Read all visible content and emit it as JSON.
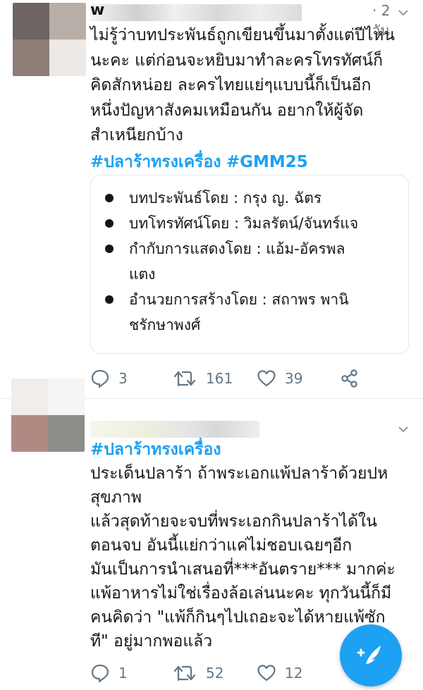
{
  "tweets": [
    {
      "author_visible_char": "w",
      "time": "· 2 วัน",
      "text_lines": [
        "ไม่รู้ว่าบทประพันธ์ถูกเขียนขึ้นมาตั้งแต่ปีไหน",
        "นะคะ แต่ก่อนจะหยิบมาทำละครโทรทัศน์ก็",
        "คิดสักหน่อย ละครไทยแย่ๆแบบนี้ก็เป็นอีก",
        "หนึ่งปัญหาสังคมเหมือนกัน อยากให้ผู้จัด",
        "สำเหนียกบ้าง"
      ],
      "hashtags": [
        "#ปลาร้าทรงเครื่อง",
        "#GMM25"
      ],
      "card_items": [
        [
          "บทประพันธ์โดย : กรุง ญ. ฉัตร"
        ],
        [
          "บทโทรทัศน์โดย : วิมลรัตน์/จันทร์แจ"
        ],
        [
          "กำกับการแสดงโดย : แอ้ม-อัครพล ",
          "แตง"
        ],
        [
          "อำนวยการสร้างโดย : สถาพร พานิ",
          "ชรักษาพงศ์"
        ]
      ],
      "replies": "3",
      "retweets": "161",
      "likes": "39"
    },
    {
      "hashtag": "#ปลาร้าทรงเครื่อง",
      "text_lines": [
        "ประเด็นปลาร้า ถ้าพระเอกแพ้ปลาร้าด้วยปห",
        "สุขภาพ",
        "แล้วสุดท้ายจะจบที่พระเอกกินปลาร้าได้ใน",
        "ตอนจบ อันนี้แย่กว่าแค่ไม่ชอบเฉยๆอีก",
        "มันเป็นการนำเสนอที่***อันตราย*** มากค่ะ",
        "แพ้อาหารไม่ใช่เรื่องล้อเล่นนะคะ ทุกวันนี้ก็มี",
        "คนคิดว่า \"แพ้ก็กินๆไปเถอะจะได้หายแพ้ซัก",
        "ที\" อยู่มากพอแล้ว"
      ],
      "replies": "1",
      "retweets": "52",
      "likes": "12"
    }
  ],
  "icons": {
    "reply": "reply-icon",
    "retweet": "retweet-icon",
    "like": "heart-icon",
    "share": "share-icon",
    "menu": "chevron-down-icon",
    "compose": "compose-tweet-icon"
  },
  "colors": {
    "accent": "#1da1f2",
    "text": "#14171a",
    "muted": "#657786",
    "border": "#e1e8ed"
  }
}
